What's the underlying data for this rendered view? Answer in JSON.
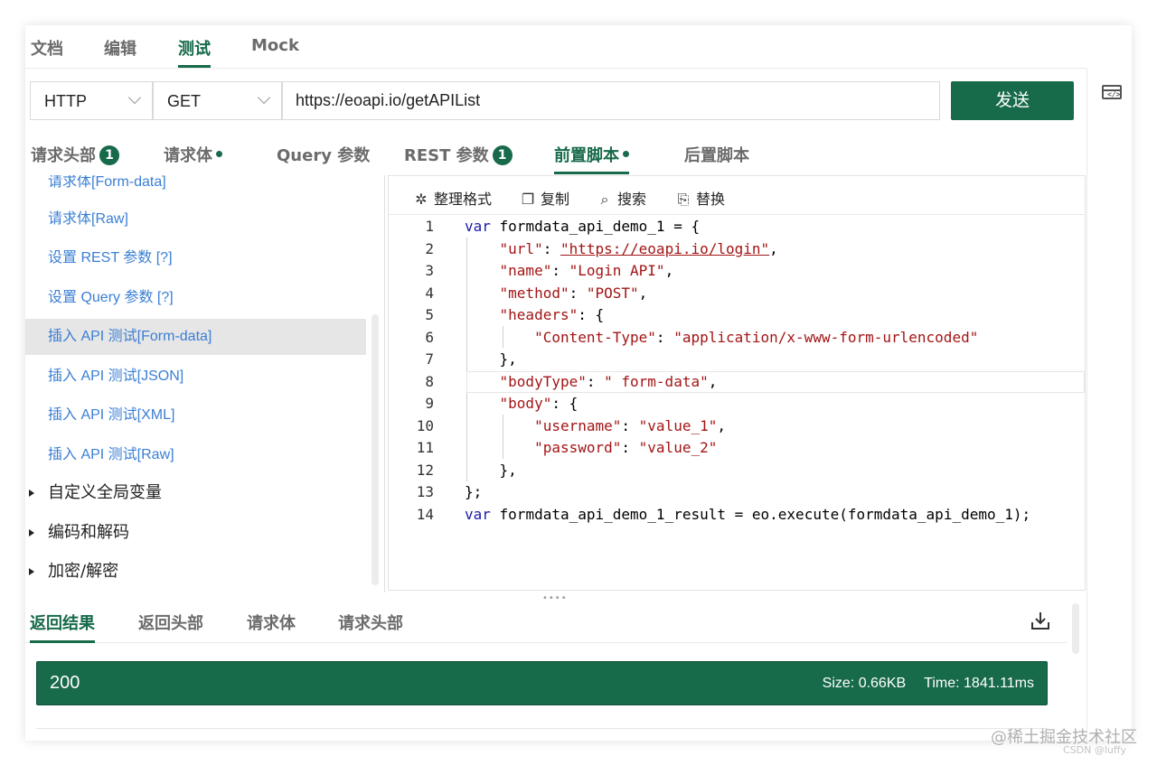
{
  "top_tabs": [
    "文档",
    "编辑",
    "测试",
    "Mock"
  ],
  "request": {
    "protocol": "HTTP",
    "method": "GET",
    "url": "https://eoapi.io/getAPIList",
    "send_label": "发送"
  },
  "sub_tabs": {
    "headers": "请求头部",
    "headers_count": "1",
    "body": "请求体",
    "query": "Query 参数",
    "rest": "REST 参数",
    "rest_count": "1",
    "pre_script": "前置脚本",
    "post_script": "后置脚本"
  },
  "snippets": [
    "请求体[Form-data]",
    "请求体[Raw]",
    "设置 REST 参数 [?]",
    "设置 Query 参数 [?]",
    "插入 API 测试[Form-data]",
    "插入 API 测试[JSON]",
    "插入 API 测试[XML]",
    "插入 API 测试[Raw]"
  ],
  "groups": [
    "自定义全局变量",
    "编码和解码",
    "加密/解密"
  ],
  "toolbar": {
    "format": "整理格式",
    "copy": "复制",
    "search": "搜索",
    "replace": "替换"
  },
  "code": {
    "line_numbers": [
      "1",
      "2",
      "3",
      "4",
      "5",
      "6",
      "7",
      "8",
      "9",
      "10",
      "11",
      "12",
      "13",
      "14"
    ],
    "var_kw": "var",
    "l1_rest": " formdata_api_demo_1 = {",
    "l2_key": "\"url\"",
    "l2_val": "\"https://eoapi.io/login\"",
    "l3_key": "\"name\"",
    "l3_val": "\"Login API\"",
    "l4_key": "\"method\"",
    "l4_val": "\"POST\"",
    "l5_key": "\"headers\"",
    "l6_key": "\"Content-Type\"",
    "l6_val": "\"application/x-www-form-urlencoded\"",
    "l7": "},",
    "l8_key": "\"bodyType\"",
    "l8_val": "\" form-data\"",
    "l9_key": "\"body\"",
    "l10_key": "\"username\"",
    "l10_val": "\"value_1\"",
    "l11_key": "\"password\"",
    "l11_val": "\"value_2\"",
    "l12": "},",
    "l13": "};",
    "l14_rest": " formdata_api_demo_1_result = eo.execute(formdata_api_demo_1);"
  },
  "response": {
    "tabs": [
      "返回结果",
      "返回头部",
      "请求体",
      "请求头部"
    ],
    "status": "200",
    "size": "Size: 0.66KB",
    "time": "Time: 1841.11ms"
  },
  "watermark": {
    "main": "@稀土掘金技术社区",
    "sub": "CSDN @luffy"
  },
  "colors": {
    "accent": "#176a4a",
    "link": "#3b7fd4"
  }
}
